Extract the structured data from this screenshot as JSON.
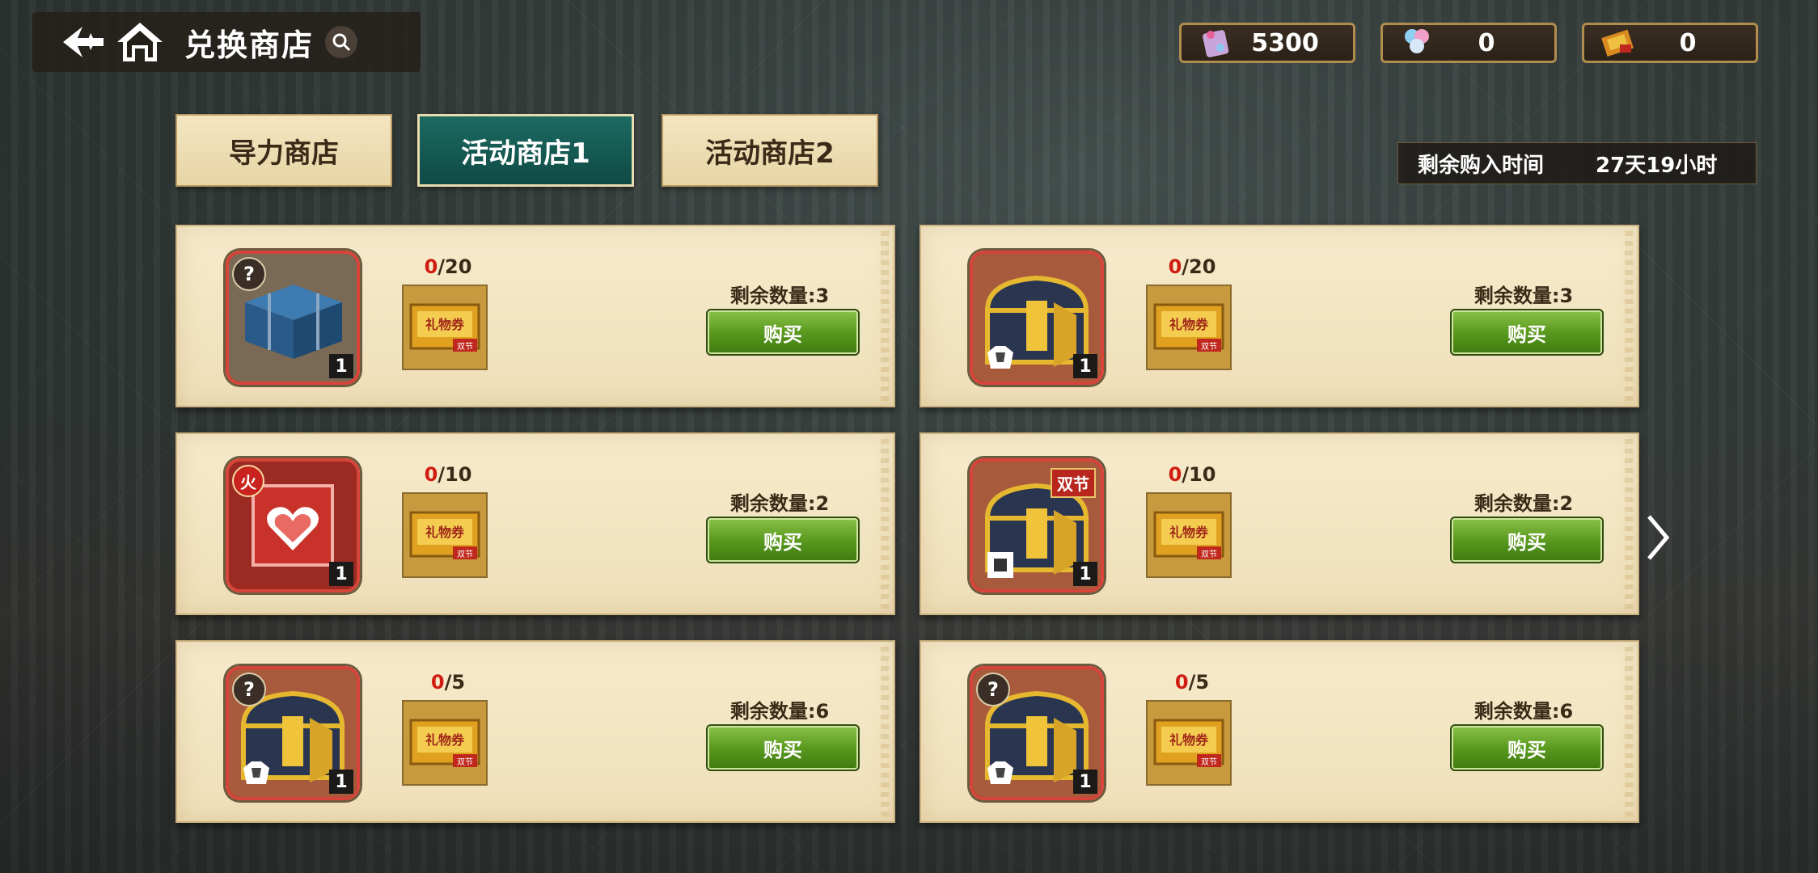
{
  "header": {
    "title": "兑换商店",
    "back_icon": "back-arrow-icon",
    "home_icon": "home-icon",
    "search_icon": "search-icon"
  },
  "currencies": [
    {
      "icon": "crystal-ticket-icon",
      "value": "5300"
    },
    {
      "icon": "balloon-ticket-icon",
      "value": "0"
    },
    {
      "icon": "gift-voucher-icon",
      "value": "0"
    }
  ],
  "tabs": [
    {
      "label": "导力商店",
      "active": false
    },
    {
      "label": "活动商店1",
      "active": true
    },
    {
      "label": "活动商店2",
      "active": false
    }
  ],
  "timer": {
    "label": "剩余购入时间",
    "value": "27天19小时"
  },
  "items": [
    {
      "icon": "blue-chest-icon",
      "badge": "?",
      "qty": "1",
      "cost_have": "0",
      "cost_total": "/20",
      "remaining": "剩余数量:3",
      "buy_label": "购买"
    },
    {
      "icon": "gold-chest-icon",
      "badge": "",
      "qty": "1",
      "cost_have": "0",
      "cost_total": "/20",
      "remaining": "剩余数量:3",
      "buy_label": "购买"
    },
    {
      "icon": "heart-potion-icon",
      "badge": "火",
      "qty": "1",
      "cost_have": "0",
      "cost_total": "/10",
      "remaining": "剩余数量:2",
      "buy_label": "购买"
    },
    {
      "icon": "gold-chest-icon",
      "badge": "双节",
      "qty": "1",
      "cost_have": "0",
      "cost_total": "/10",
      "remaining": "剩余数量:2",
      "buy_label": "购买"
    },
    {
      "icon": "gold-chest-icon",
      "badge": "?",
      "qty": "1",
      "cost_have": "0",
      "cost_total": "/5",
      "remaining": "剩余数量:6",
      "buy_label": "购买"
    },
    {
      "icon": "gold-chest-icon",
      "badge": "?",
      "qty": "1",
      "cost_have": "0",
      "cost_total": "/5",
      "remaining": "剩余数量:6",
      "buy_label": "购买"
    }
  ],
  "cost_icon": {
    "icon": "gift-voucher-icon",
    "text": "礼物券",
    "tag": "双节"
  },
  "next_page_icon": "chevron-right-icon"
}
